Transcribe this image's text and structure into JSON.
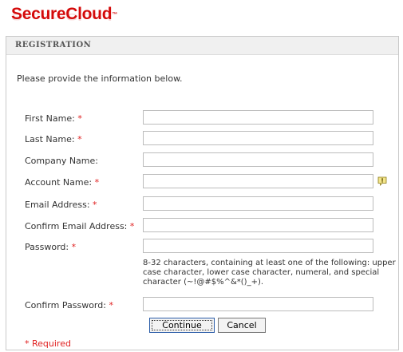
{
  "brand": {
    "name": "SecureCloud",
    "tm": "™"
  },
  "panel": {
    "title": "REGISTRATION"
  },
  "intro": "Please provide the information below.",
  "fields": [
    {
      "label": "First Name:",
      "required": "*",
      "value": ""
    },
    {
      "label": "Last Name:",
      "required": "*",
      "value": ""
    },
    {
      "label": "Company Name:",
      "required": "",
      "value": ""
    },
    {
      "label": "Account Name:",
      "required": "*",
      "value": ""
    },
    {
      "label": "Email Address:",
      "required": "*",
      "value": ""
    },
    {
      "label": "Confirm Email Address:",
      "required": "*",
      "value": ""
    },
    {
      "label": "Password:",
      "required": "*",
      "value": ""
    },
    {
      "label": "Confirm Password:",
      "required": "*",
      "value": ""
    }
  ],
  "password_hint": "8-32 characters, containing at least one of the following: upper case character, lower case character, numeral, and special character (~!@#$%^&*()_+).",
  "buttons": {
    "continue": "Continue",
    "cancel": "Cancel"
  },
  "required_note": "* Required",
  "colors": {
    "brand": "#d40a0a",
    "required": "#e02020",
    "header_bg": "#f0f0f0"
  },
  "icons": {
    "account_info": "info-icon"
  }
}
